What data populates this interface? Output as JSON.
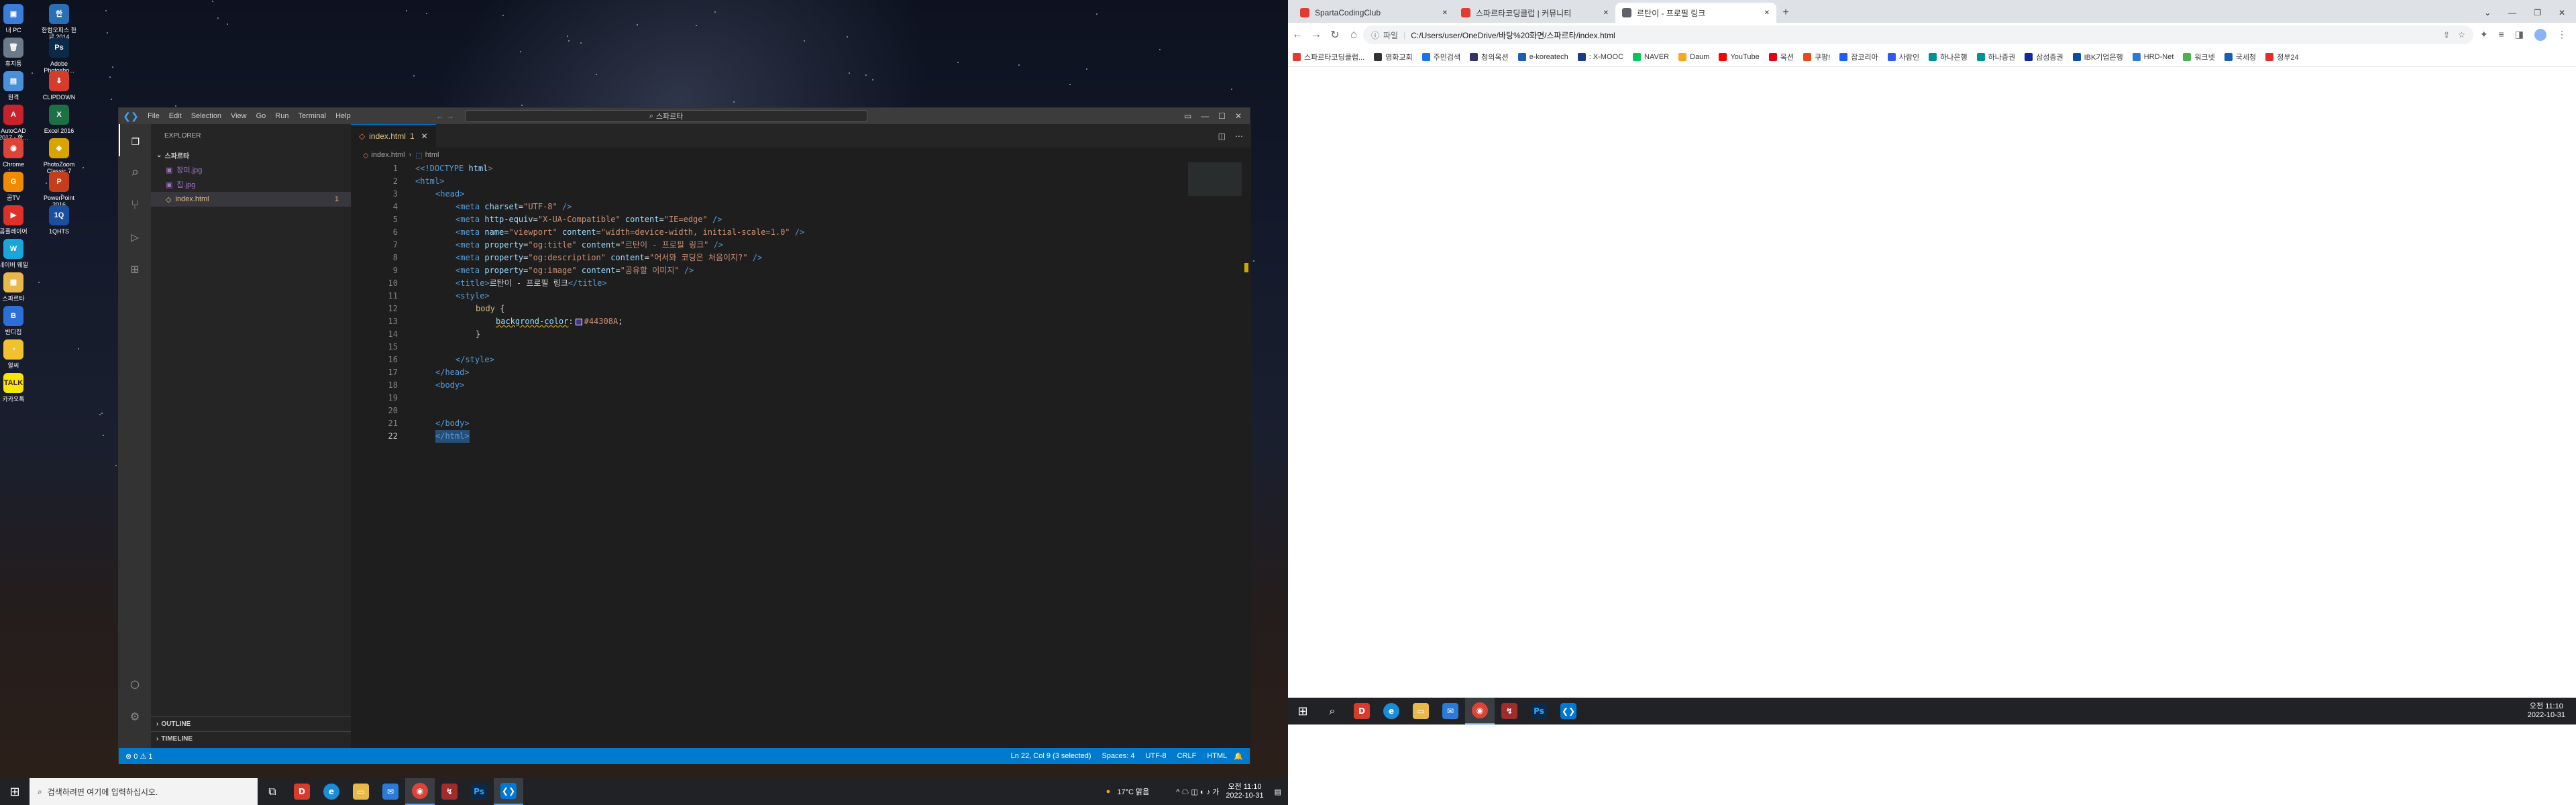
{
  "desktop": {
    "icons": [
      {
        "label": "내 PC",
        "icon": "computer-icon",
        "color": "#3b7dd8",
        "glyph": "▣"
      },
      {
        "label": "한컴오피스 한글 2014",
        "icon": "hwp-icon",
        "color": "#2a6fb5",
        "glyph": "한"
      },
      {
        "label": "휴지통",
        "icon": "trash-icon",
        "color": "#6d7a8a",
        "glyph": "🗑"
      },
      {
        "label": "Adobe Photosho...",
        "icon": "photoshop-icon",
        "color": "#0b2a4a",
        "glyph": "Ps"
      },
      {
        "label": "원격",
        "icon": "remote-icon",
        "color": "#4a8fd8",
        "glyph": "▤"
      },
      {
        "label": "CLIPDOWN",
        "icon": "download-icon",
        "color": "#d83b2b",
        "glyph": "⬇"
      },
      {
        "label": "AutoCAD 2017 - 한...",
        "icon": "autocad-icon",
        "color": "#c8232c",
        "glyph": "A"
      },
      {
        "label": "Excel 2016",
        "icon": "excel-icon",
        "color": "#1d7044",
        "glyph": "X"
      },
      {
        "label": "Chrome",
        "icon": "chrome-icon",
        "color": "#db4437",
        "glyph": "◉"
      },
      {
        "label": "PhotoZoom Classic 7",
        "icon": "photozoom-icon",
        "color": "#d9a400",
        "glyph": "◈"
      },
      {
        "label": "곰TV",
        "icon": "gomtv-icon",
        "color": "#f08a00",
        "glyph": "G"
      },
      {
        "label": "PowerPoint 2016",
        "icon": "powerpoint-icon",
        "color": "#c43e1c",
        "glyph": "P"
      },
      {
        "label": "곰플레이어",
        "icon": "gomplayer-icon",
        "color": "#e0302a",
        "glyph": "▶"
      },
      {
        "label": "1QHTS",
        "icon": "hts-icon",
        "color": "#1a4fa0",
        "glyph": "1Q"
      },
      {
        "label": "네이버 웨일",
        "icon": "whale-icon",
        "color": "#1aa6d9",
        "glyph": "W"
      },
      {
        "label": "스파르타",
        "icon": "folder-icon",
        "color": "#e9b84a",
        "glyph": "▦"
      },
      {
        "label": "반디집",
        "icon": "bandizip-icon",
        "color": "#2c6fd6",
        "glyph": "B"
      },
      {
        "label": "알씨",
        "icon": "alsee-icon",
        "color": "#f2c12e",
        "glyph": "◔"
      },
      {
        "label": "카카오톡",
        "icon": "kakaotalk-icon",
        "color": "#f7e600",
        "glyph": "TALK"
      }
    ]
  },
  "taskbar1": {
    "search_placeholder": "검색하려면 여기에 입력하십시오.",
    "weather": "17°C 맑음",
    "time": "오전 11:10",
    "date": "2022-10-31",
    "tray": "^ ☁ ◫ ◐ ♪ 가"
  },
  "vscode": {
    "menus": [
      "File",
      "Edit",
      "Selection",
      "View",
      "Go",
      "Run",
      "Terminal",
      "Help"
    ],
    "search": "스파르타",
    "explorer_title": "EXPLORER",
    "folder": "스파르타",
    "files": [
      {
        "name": "장미.jpg",
        "color": "#a074c4"
      },
      {
        "name": "집.jpg",
        "color": "#a074c4"
      },
      {
        "name": "index.html",
        "color": "#e2c08d",
        "badge": "1"
      }
    ],
    "outline": "OUTLINE",
    "timeline": "TIMELINE",
    "tab": "index.html",
    "tab_badge": "1",
    "breadcrumb": [
      "index.html",
      "html"
    ],
    "lines": [
      "1",
      "2",
      "3",
      "4",
      "5",
      "6",
      "7",
      "8",
      "9",
      "10",
      "11",
      "12",
      "13",
      "14",
      "15",
      "16",
      "17",
      "18",
      "19",
      "20",
      "21",
      "22"
    ],
    "status_left": "⊗ 0 ⚠ 1",
    "status_right": [
      "Ln 22, Col 9 (3 selected)",
      "Spaces: 4",
      "UTF-8",
      "CRLF",
      "HTML"
    ],
    "code": {
      "l1a": "<!DOCTYPE",
      "l1b": " html",
      "l1c": ">",
      "l2": "<html>",
      "l3": "<head>",
      "l4a": "<meta",
      "l4b": " charset",
      "l4c": "=",
      "l4d": "\"UTF-8\"",
      "l4e": " />",
      "l5a": "<meta",
      "l5b": " http-equiv",
      "l5c": "=",
      "l5d": "\"X-UA-Compatible\"",
      "l5e": " content",
      "l5f": "=",
      "l5g": "\"IE=edge\"",
      "l5h": " />",
      "l6a": "<meta",
      "l6b": " name",
      "l6c": "=",
      "l6d": "\"viewport\"",
      "l6e": " content",
      "l6f": "=",
      "l6g": "\"width=device-width, initial-scale=1.0\"",
      "l6h": " />",
      "l7a": "<meta",
      "l7b": " property",
      "l7c": "=",
      "l7d": "\"og:title\"",
      "l7e": " content",
      "l7f": "=",
      "l7g": "\"르탄이 - 프로필 링크\"",
      "l7h": " />",
      "l8a": "<meta",
      "l8b": " property",
      "l8c": "=",
      "l8d": "\"og:description\"",
      "l8e": " content",
      "l8f": "=",
      "l8g": "\"어서와 코딩은 처음이지?\"",
      "l8h": " />",
      "l9a": "<meta",
      "l9b": " property",
      "l9c": "=",
      "l9d": "\"og:image\"",
      "l9e": " content",
      "l9f": "=",
      "l9g": "\"공유할 이미지\"",
      "l9h": " />",
      "l10a": "<title>",
      "l10b": "르탄이 - 프로필 링크",
      "l10c": "</title>",
      "l11": "<style>",
      "l12a": "body",
      "l12b": " {",
      "l13a": "backgrond-color",
      "l13b": ":",
      "l13c": "#44308A",
      "l13d": ";",
      "l14": "}",
      "l16": "</style>",
      "l17": "</head>",
      "l18": "<body>",
      "l21": "</body>",
      "l22": "</html>"
    }
  },
  "chrome": {
    "tabs": [
      {
        "title": "SpartaCodingClub",
        "color": "#e03c31"
      },
      {
        "title": "스파르타코딩클럽 | 커뮤니티",
        "color": "#e03c31"
      },
      {
        "title": "르탄이 - 프로필 링크",
        "color": "#5f6368"
      }
    ],
    "url_prefix": "파일",
    "url": "C:/Users/user/OneDrive/바탕%20화면/스파르타/index.html",
    "bookmarks": [
      {
        "label": "스파르타코딩클럽...",
        "color": "#e03c31"
      },
      {
        "label": "영화교회",
        "color": "#333333"
      },
      {
        "label": "주민검색",
        "color": "#1a73e8"
      },
      {
        "label": "청의옥션",
        "color": "#333366"
      },
      {
        "label": "e-koreatech",
        "color": "#1a5fb4"
      },
      {
        "label": ": X-MOOC",
        "color": "#1a3a8a"
      },
      {
        "label": "NAVER",
        "color": "#03c75a"
      },
      {
        "label": "Daum",
        "color": "#f5a623"
      },
      {
        "label": "YouTube",
        "color": "#ff0000"
      },
      {
        "label": "옥션",
        "color": "#e60012"
      },
      {
        "label": "쿠팡!",
        "color": "#e64a19"
      },
      {
        "label": "잡코리아",
        "color": "#1e5eff"
      },
      {
        "label": "사람인",
        "color": "#2f5bea"
      },
      {
        "label": "하나은행",
        "color": "#009490"
      },
      {
        "label": "하나증권",
        "color": "#009490"
      },
      {
        "label": "삼성증권",
        "color": "#1428a0"
      },
      {
        "label": "IBK기업은행",
        "color": "#0a4da2"
      },
      {
        "label": "HRD-Net",
        "color": "#2b7bd6"
      },
      {
        "label": "워크넷",
        "color": "#4caf50"
      },
      {
        "label": "국세청",
        "color": "#1a5fb4"
      },
      {
        "label": "정부24",
        "color": "#e0302a"
      }
    ]
  },
  "taskbar2": {
    "time": "오전 11:10",
    "date": "2022-10-31"
  },
  "colors": {
    "vs_bg": "#1e1e1e",
    "vs_status": "#007acc",
    "swatch": "#44308A",
    "taskbar": "#202225"
  }
}
